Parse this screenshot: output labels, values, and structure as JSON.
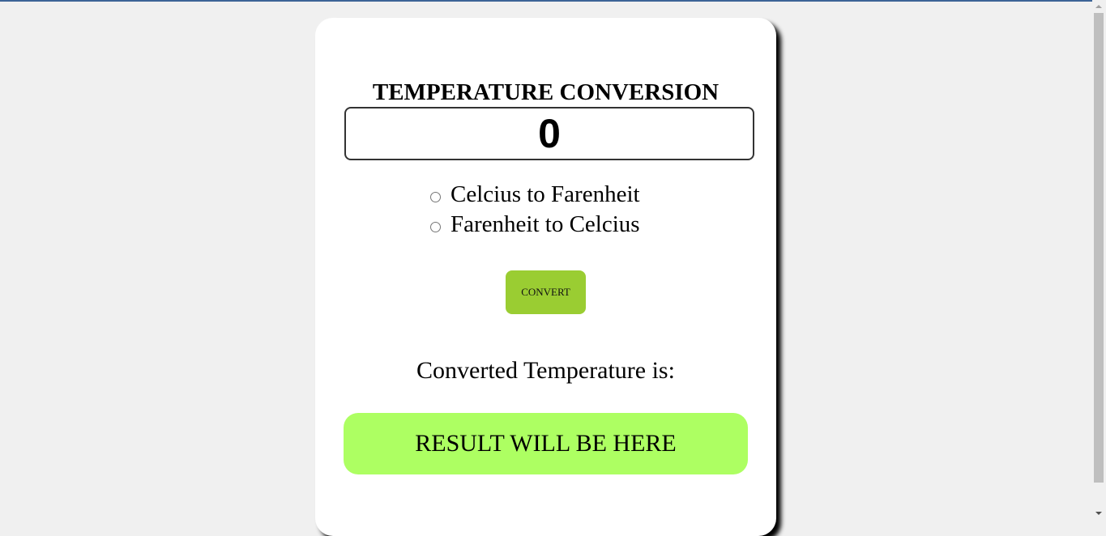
{
  "title": "TEMPERATURE CONVERSION",
  "input": {
    "value": "0"
  },
  "options": [
    {
      "label": "Celcius to Farenheit",
      "selected": false
    },
    {
      "label": "Farenheit to Celcius",
      "selected": false
    }
  ],
  "convert_label": "CONVERT",
  "result_label": "Converted Temperature is:",
  "result_text": "RESULT WILL BE HERE",
  "colors": {
    "button": "#9acd32",
    "result": "#adff62"
  }
}
